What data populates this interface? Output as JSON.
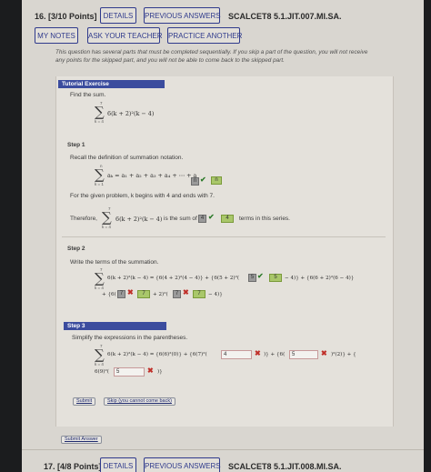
{
  "q16": {
    "title": "16. [3/10 Points]",
    "details": "DETAILS",
    "previous": "PREVIOUS ANSWERS",
    "code": "SCALCET8 5.1.JIT.007.MI.SA.",
    "my_notes": "MY NOTES",
    "ask_teacher": "ASK YOUR TEACHER",
    "practice": "PRACTICE ANOTHER",
    "notice_line1": "This question has several parts that must be completed sequentially. If you skip a part of the question, you will not receive",
    "notice_line2": "any points for the skipped part, and you will not be able to come back to the skipped part."
  },
  "tutorial": {
    "bar": "Tutorial Exercise",
    "find_sum": "Find the sum.",
    "upper": "7",
    "lower": "k = 4",
    "main_expr": "6(k + 2)²(k − 4)"
  },
  "step1": {
    "label": "Step 1",
    "recall": "Recall the definition of summation notation.",
    "def_upper": "n",
    "def_lower": "k = 1",
    "def_expr": "aₖ = a₁ + a₂ + a₃ + a₄ + ⋯ + a",
    "box_sub": "n",
    "box_val": "n",
    "given": "For the given problem, k begins with 4 and ends with 7.",
    "therefore": "Therefore,",
    "expr": "6(k + 2)²(k − 4)",
    "is_sum_of": "is the sum of",
    "num_val": "4",
    "num_box": "4",
    "terms": "terms in this series."
  },
  "step2": {
    "label": "Step 2",
    "write": "Write the terms of the summation.",
    "line1_a": "6(k + 2)²(k − 4) = {6(4 + 2)²(4 − 4)} + {6(5 + 2)²(",
    "box1": "5",
    "box1_ans": "5",
    "line1_b": "− 4)} + {6(6 + 2)²(6 − 4)}",
    "line2_a": "+ {6(",
    "box2": "7",
    "box2_ans": "7",
    "line2_b": "+ 2)²(",
    "box3": "7",
    "box3_ans": "7",
    "line2_c": "− 4)}"
  },
  "step3": {
    "bar": "Step 3",
    "simplify": "Simplify the expressions in the parentheses.",
    "line1_a": "6(k + 2)²(k − 4) = {6(6)²(0)} + {6(7)²(",
    "input1": "4",
    "line1_b": ")} + {6(",
    "input2": "5",
    "line1_c": ")²(2)} + {",
    "line2_a": "6(9)²(",
    "input3": "5",
    "line2_b": ")}"
  },
  "actions": {
    "submit": "Submit",
    "skip": "Skip (you cannot come back)",
    "submit_answer": "Submit Answer"
  },
  "q17": {
    "title": "17. [4/8 Points]",
    "details": "DETAILS",
    "previous": "PREVIOUS ANSWERS",
    "code": "SCALCET8 5.1.JIT.008.MI.SA."
  }
}
